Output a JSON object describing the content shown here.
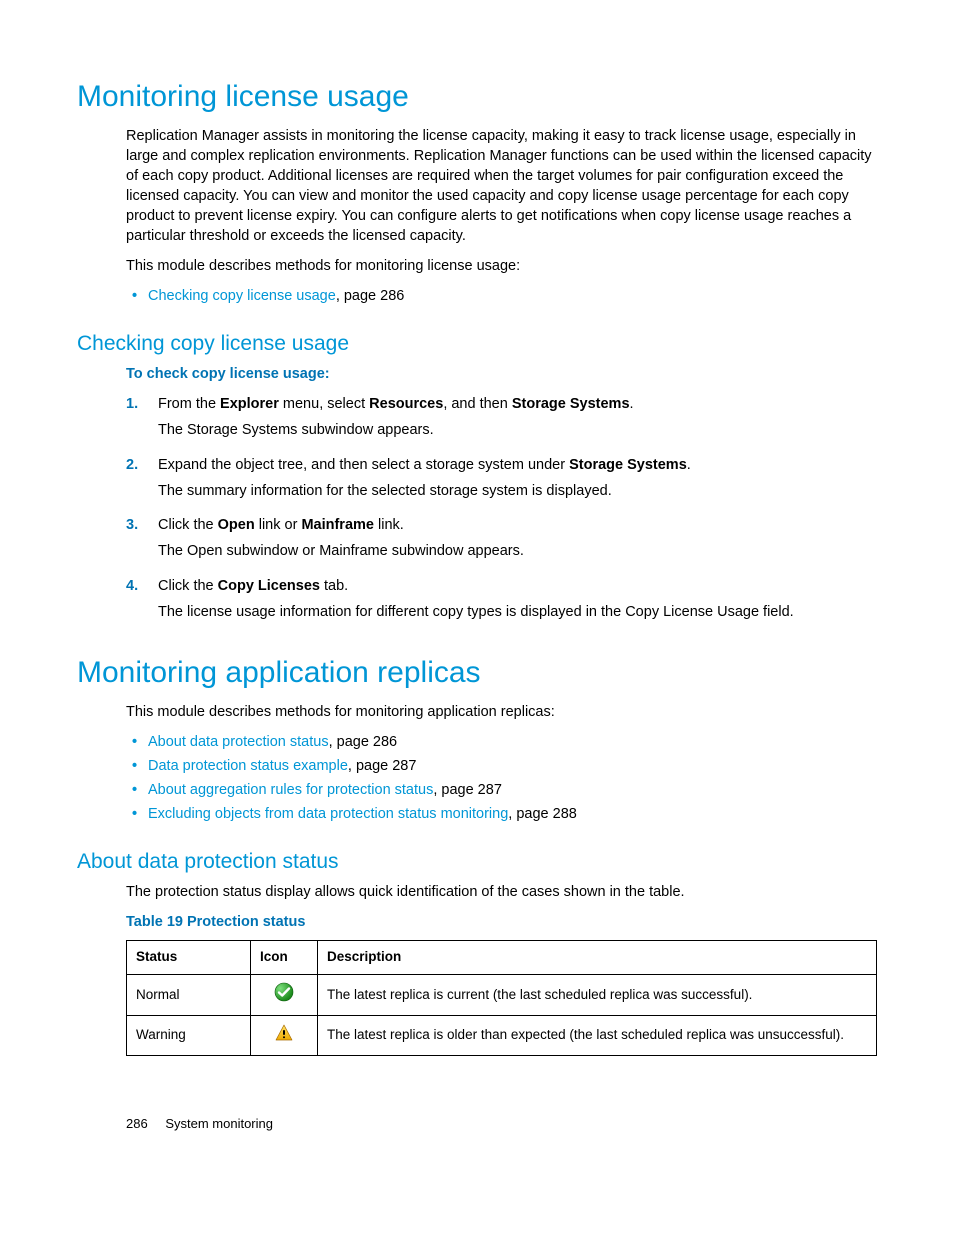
{
  "sec1": {
    "title": "Monitoring license usage",
    "para1": "Replication Manager assists in monitoring the license capacity, making it easy to track license usage, especially in large and complex replication environments. Replication Manager functions can be used within the licensed capacity of each copy product. Additional licenses are required when the target volumes for pair configuration exceed the licensed capacity. You can view and monitor the used capacity and copy license usage percentage for each copy product to prevent license expiry. You can configure alerts to get notifications when copy license usage reaches a particular threshold or exceeds the licensed capacity.",
    "para2": "This module describes methods for monitoring license usage:",
    "bullets": [
      {
        "link": "Checking copy license usage",
        "suffix": ", page 286"
      }
    ]
  },
  "sec2": {
    "title": "Checking copy license usage",
    "proc_title": "To check copy license usage:",
    "steps": [
      {
        "num": "1.",
        "main_parts": [
          "From the ",
          "Explorer",
          " menu, select ",
          "Resources",
          ", and then ",
          "Storage Systems",
          "."
        ],
        "sub": "The Storage Systems subwindow appears."
      },
      {
        "num": "2.",
        "main_parts": [
          "Expand the object tree, and then select a storage system under ",
          "Storage Systems",
          "."
        ],
        "sub": "The summary information for the selected storage system is displayed."
      },
      {
        "num": "3.",
        "main_parts": [
          "Click the ",
          "Open",
          " link or ",
          "Mainframe",
          " link."
        ],
        "sub": "The Open subwindow or Mainframe subwindow appears."
      },
      {
        "num": "4.",
        "main_parts": [
          "Click the ",
          "Copy Licenses",
          " tab."
        ],
        "sub": "The license usage information for different copy types is displayed in the Copy License Usage field."
      }
    ]
  },
  "sec3": {
    "title": "Monitoring application replicas",
    "para1": "This module describes methods for monitoring application replicas:",
    "bullets": [
      {
        "link": "About data protection status",
        "suffix": ", page 286"
      },
      {
        "link": "Data protection status example",
        "suffix": ", page 287"
      },
      {
        "link": "About aggregation rules for protection status",
        "suffix": ", page 287"
      },
      {
        "link": "Excluding objects from data protection status monitoring",
        "suffix": ", page 288"
      }
    ]
  },
  "sec4": {
    "title": "About data protection status",
    "para1": "The protection status display allows quick identification of the cases shown in the table.",
    "table_caption": "Table 19 Protection status",
    "headers": {
      "c1": "Status",
      "c2": "Icon",
      "c3": "Description"
    },
    "rows": [
      {
        "status": "Normal",
        "icon": "check",
        "desc": "The latest replica is current (the last scheduled replica was successful)."
      },
      {
        "status": "Warning",
        "icon": "warn",
        "desc": "The latest replica is older than expected (the last scheduled replica was unsuccessful)."
      }
    ]
  },
  "footer": {
    "page": "286",
    "section": "System monitoring"
  }
}
